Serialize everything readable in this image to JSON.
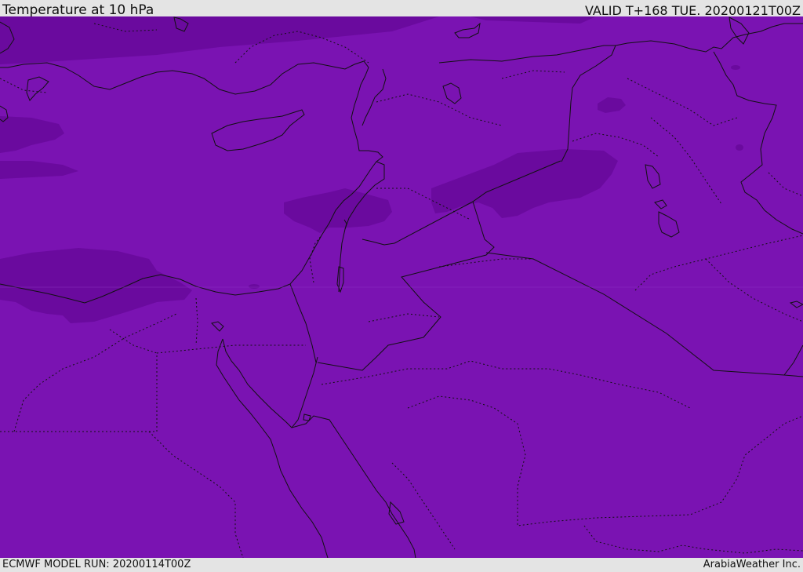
{
  "header": {
    "title": "Temperature at 10 hPa",
    "valid": "VALID T+168 TUE. 20200121T00Z"
  },
  "footer": {
    "model_run": "ECMWF MODEL RUN: 20200114T00Z",
    "credit": "ArabiaWeather Inc."
  },
  "colors": {
    "field_base": "#7a13b2",
    "field_colder": "#6a0a9e",
    "borders": "#111111",
    "frame": "#e4e4e4"
  }
}
